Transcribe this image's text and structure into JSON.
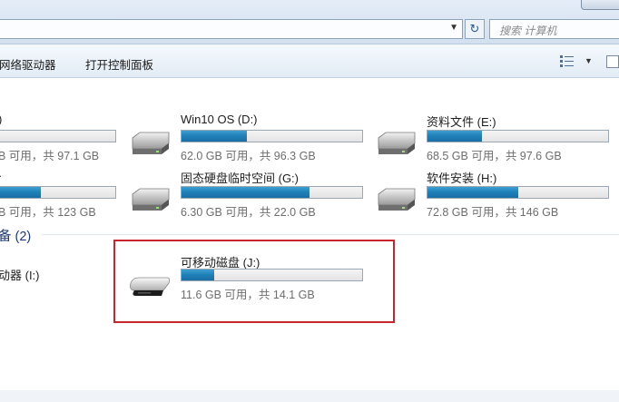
{
  "address_bar": {
    "dropdown_icon": "chevron-down-icon",
    "refresh_icon": "refresh-icon"
  },
  "search": {
    "placeholder": "搜索 计算机"
  },
  "toolbar": {
    "buttons": [
      "网络驱动器",
      "打开控制面板"
    ],
    "view_icon": "view-options-icon",
    "preview_icon": "preview-pane-icon"
  },
  "hard_disks": [
    {
      "name": "",
      "usage_fraction": 0.0,
      "free_text": "B 可用，共 97.1 GB"
    },
    {
      "name": "Win10 OS (D:)",
      "usage_fraction": 0.36,
      "free_text": "62.0 GB 可用，共 96.3 GB"
    },
    {
      "name": "资料文件 (E:)",
      "usage_fraction": 0.3,
      "free_text": "68.5 GB 可用，共 97.6 GB"
    },
    {
      "name": "",
      "usage_fraction": 0.36,
      "free_text": "B 可用，共 123 GB"
    },
    {
      "name": "固态硬盘临时空间 (G:)",
      "usage_fraction": 0.71,
      "free_text": "6.30 GB 可用，共 22.0 GB"
    },
    {
      "name": "软件安装 (H:)",
      "usage_fraction": 0.5,
      "free_text": "72.8 GB 可用，共 146 GB"
    }
  ],
  "removable_section": {
    "title": "备 (2)",
    "partial_item": "动器 (I:)",
    "drive": {
      "name": "可移动磁盘 (J:)",
      "usage_fraction": 0.18,
      "free_text": "11.6 GB 可用，共 14.1 GB"
    }
  },
  "colors": {
    "bar_fill": "#1f7fb8",
    "highlight_border": "#c8262c",
    "section_title": "#1e3a78"
  }
}
